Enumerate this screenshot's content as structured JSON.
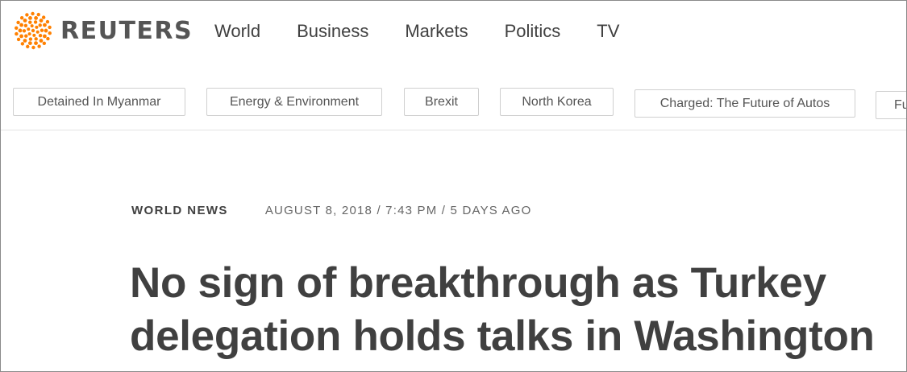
{
  "header": {
    "logo_text": "REUTERS",
    "brand_color": "#ff8000",
    "nav": [
      {
        "label": "World"
      },
      {
        "label": "Business"
      },
      {
        "label": "Markets"
      },
      {
        "label": "Politics"
      },
      {
        "label": "TV"
      }
    ]
  },
  "topics": [
    {
      "label": "Detained In Myanmar"
    },
    {
      "label": "Energy & Environment"
    },
    {
      "label": "Brexit"
    },
    {
      "label": "North Korea"
    },
    {
      "label": "Charged: The Future of Autos"
    },
    {
      "label": "Fu"
    }
  ],
  "article": {
    "section": "WORLD NEWS",
    "dateline": "AUGUST 8, 2018 / 7:43 PM / 5 DAYS AGO",
    "headline": "No sign of breakthrough as Turkey delegation holds talks in Washington"
  }
}
